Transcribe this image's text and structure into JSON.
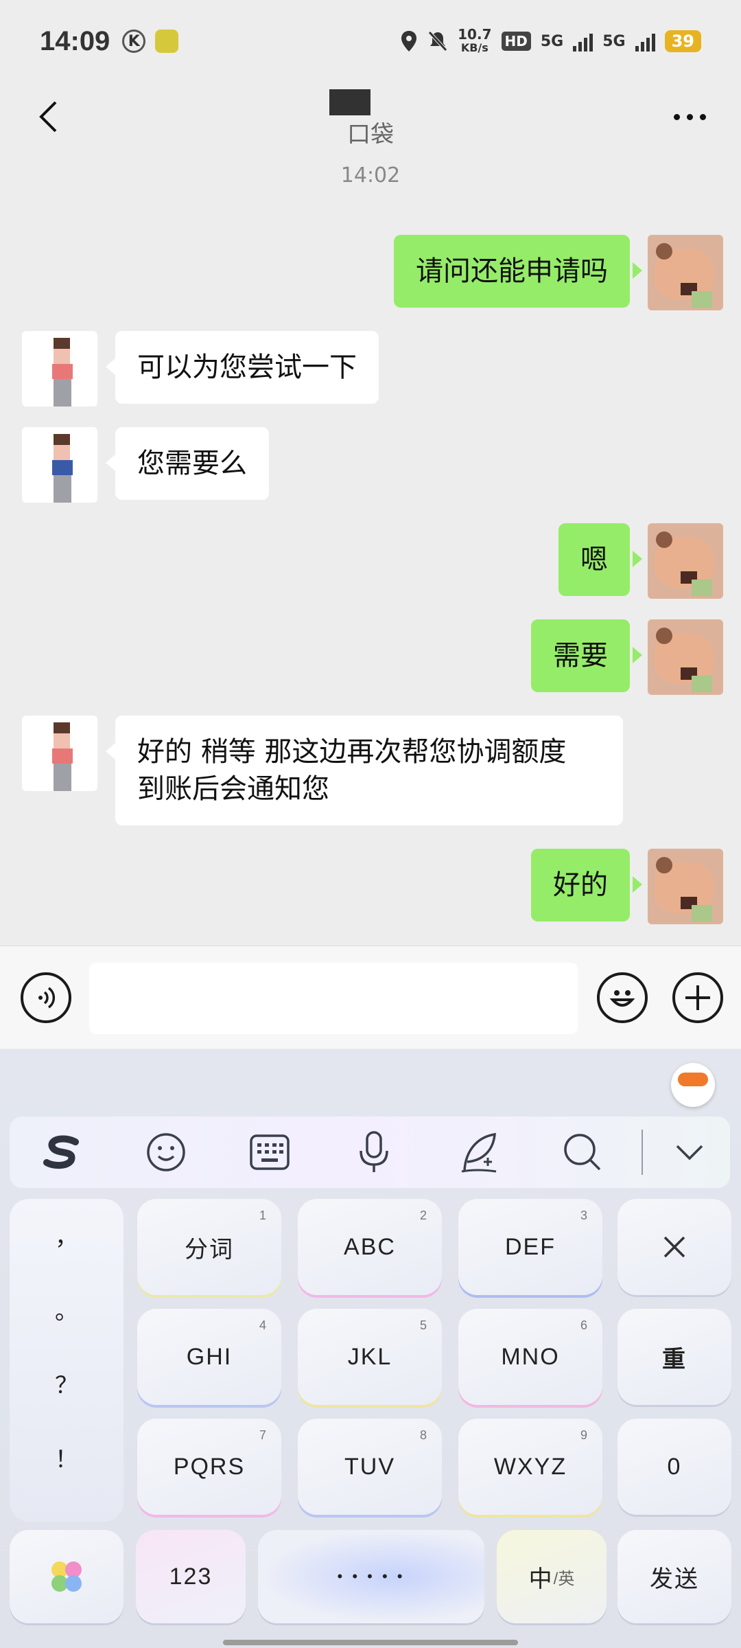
{
  "status_bar": {
    "time": "14:09",
    "k_badge": "K",
    "net_speed_value": "10.7",
    "net_speed_unit": "KB/s",
    "hd_label": "HD",
    "sim_label_1": "5G",
    "sim_label_2": "5G",
    "battery": "39"
  },
  "nav": {
    "title": "口袋",
    "more_icon": "more-dots-icon",
    "back_icon": "chevron-left-icon"
  },
  "chat": {
    "time_divider": "14:02",
    "messages": [
      {
        "side": "right",
        "text": "请问还能申请吗"
      },
      {
        "side": "left",
        "text": "可以为您尝试一下"
      },
      {
        "side": "left",
        "text": "您需要么"
      },
      {
        "side": "right",
        "text": "嗯"
      },
      {
        "side": "right",
        "text": "需要"
      },
      {
        "side": "left",
        "text": "好的 稍等 那这边再次帮您协调额度 到账后会通知您"
      },
      {
        "side": "right",
        "text": "好的"
      }
    ]
  },
  "input_bar": {
    "value": "",
    "voice_icon": "voice-icon",
    "emoji_icon": "emoji-icon",
    "plus_icon": "plus-icon"
  },
  "keyboard": {
    "toolbar": [
      "sogou-logo-icon",
      "emoji-icon",
      "keyboard-icon",
      "microphone-icon",
      "handwriting-icon",
      "search-icon",
      "collapse-icon"
    ],
    "punctuation": [
      "，",
      "。",
      "？",
      "！"
    ],
    "keys": [
      {
        "label": "分词",
        "num": "1"
      },
      {
        "label": "ABC",
        "num": "2"
      },
      {
        "label": "DEF",
        "num": "3"
      },
      {
        "label": "GHI",
        "num": "4"
      },
      {
        "label": "JKL",
        "num": "5"
      },
      {
        "label": "MNO",
        "num": "6"
      },
      {
        "label": "PQRS",
        "num": "7"
      },
      {
        "label": "TUV",
        "num": "8"
      },
      {
        "label": "WXYZ",
        "num": "9"
      }
    ],
    "reenter_key": "重",
    "zero_key": "0",
    "num_key": "123",
    "space_key": "• • • • •",
    "lang_key_main": "中",
    "lang_key_sub": "/英",
    "send_key": "发送"
  }
}
